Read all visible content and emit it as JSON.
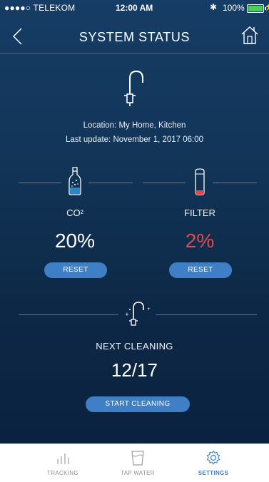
{
  "status_bar": {
    "carrier": "●●●●○ TELEKOM",
    "time": "12:00 AM",
    "battery": "100%"
  },
  "header": {
    "title": "SYSTEM STATUS"
  },
  "device": {
    "location": "Location: My Home, Kitchen",
    "last_update": "Last update: November 1, 2017 06:00"
  },
  "co2": {
    "label": "CO²",
    "value": "20%",
    "reset_label": "RESET"
  },
  "filter": {
    "label": "FILTER",
    "value": "2%",
    "reset_label": "RESET"
  },
  "cleaning": {
    "label": "NEXT CLEANING",
    "date": "12/17",
    "button_label": "START CLEANING"
  },
  "tabs": [
    {
      "label": "TRACKING",
      "icon": "bar-chart-icon"
    },
    {
      "label": "TAP WATER",
      "icon": "glass-icon"
    },
    {
      "label": "SETTINGS",
      "icon": "gear-icon"
    }
  ],
  "colors": {
    "accent": "#3f7fc5",
    "alert": "#e6474c",
    "background": "#123558",
    "battery": "#46d15a"
  }
}
